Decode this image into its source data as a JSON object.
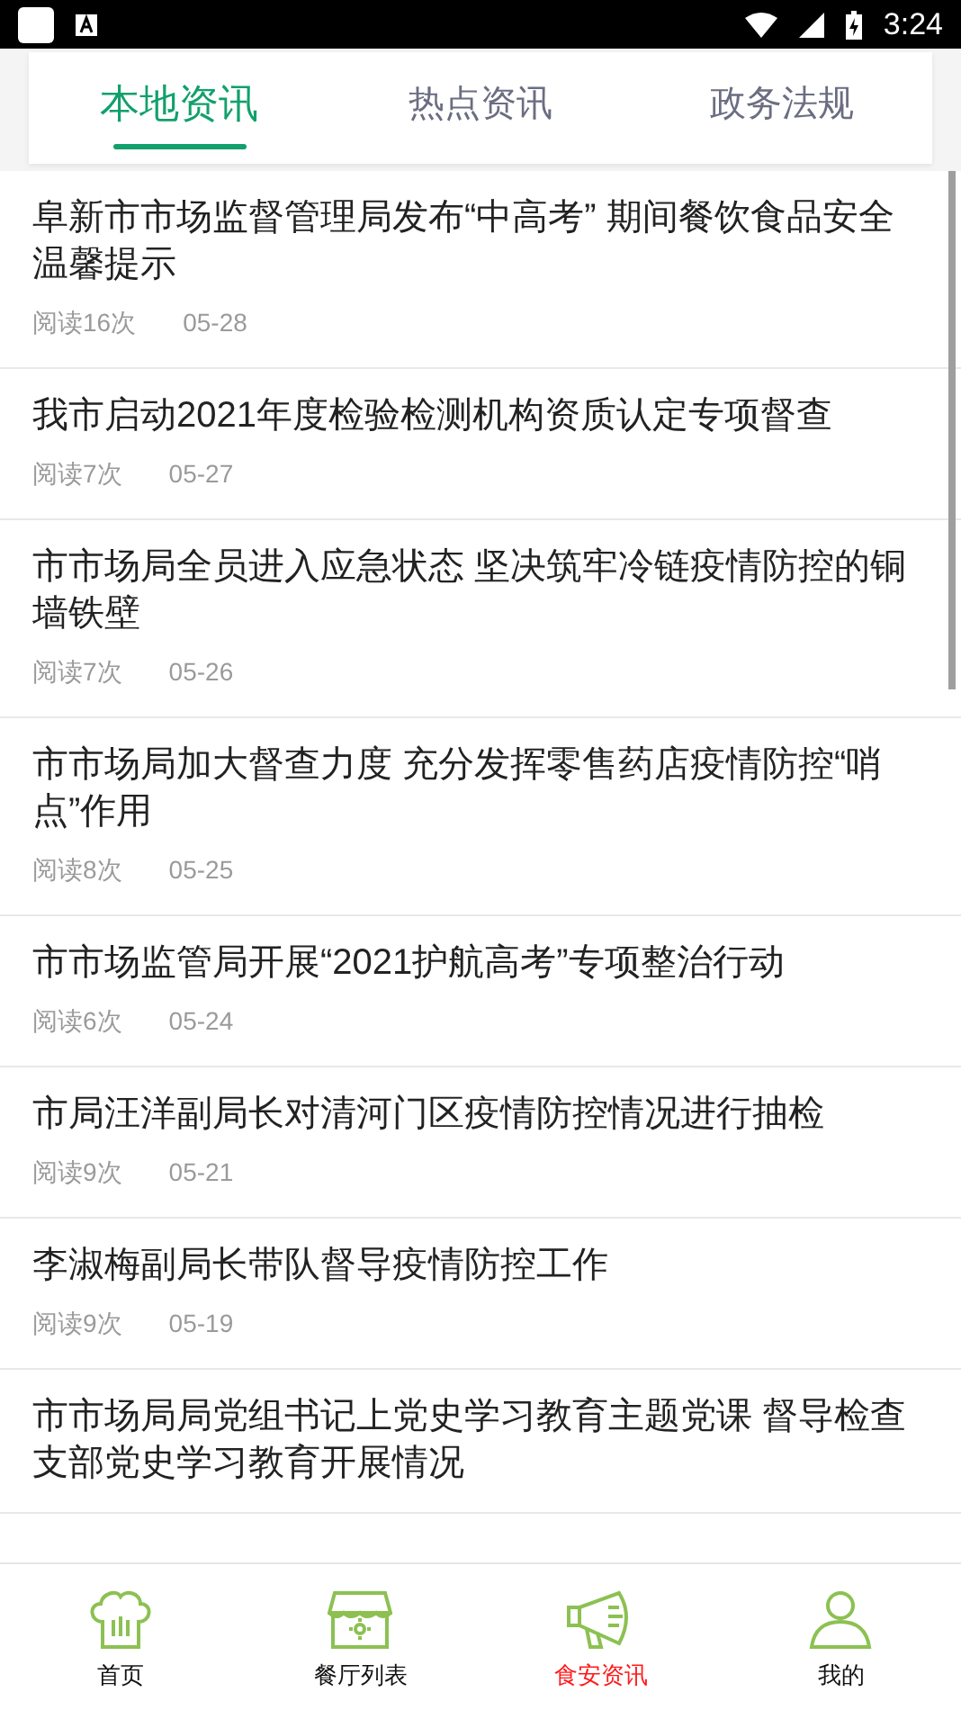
{
  "status_bar": {
    "time": "3:24"
  },
  "tabs": [
    {
      "label": "本地资讯",
      "selected": true
    },
    {
      "label": "热点资讯",
      "selected": false
    },
    {
      "label": "政务法规",
      "selected": false
    }
  ],
  "news": [
    {
      "title": "阜新市市场监督管理局发布“中高考” 期间餐饮食品安全温馨提示",
      "reads": "阅读16次",
      "date": "05-28"
    },
    {
      "title": "我市启动2021年度检验检测机构资质认定专项督查",
      "reads": "阅读7次",
      "date": "05-27"
    },
    {
      "title": "市市场局全员进入应急状态 坚决筑牢冷链疫情防控的铜墙铁壁",
      "reads": "阅读7次",
      "date": "05-26"
    },
    {
      "title": "市市场局加大督查力度 充分发挥零售药店疫情防控“哨点”作用",
      "reads": "阅读8次",
      "date": "05-25"
    },
    {
      "title": "市市场监管局开展“2021护航高考”专项整治行动",
      "reads": "阅读6次",
      "date": "05-24"
    },
    {
      "title": "市局汪洋副局长对清河门区疫情防控情况进行抽检",
      "reads": "阅读9次",
      "date": "05-21"
    },
    {
      "title": "李淑梅副局长带队督导疫情防控工作",
      "reads": "阅读9次",
      "date": "05-19"
    },
    {
      "title": "市市场局局党组书记上党史学习教育主题党课 督导检查支部党史学习教育开展情况"
    }
  ],
  "bottom_nav": [
    {
      "label": "首页",
      "kind": "chef",
      "selected": false
    },
    {
      "label": "餐厅列表",
      "kind": "shop",
      "selected": false
    },
    {
      "label": "食安资讯",
      "kind": "megaphone",
      "selected": true
    },
    {
      "label": "我的",
      "kind": "user",
      "selected": false
    }
  ]
}
